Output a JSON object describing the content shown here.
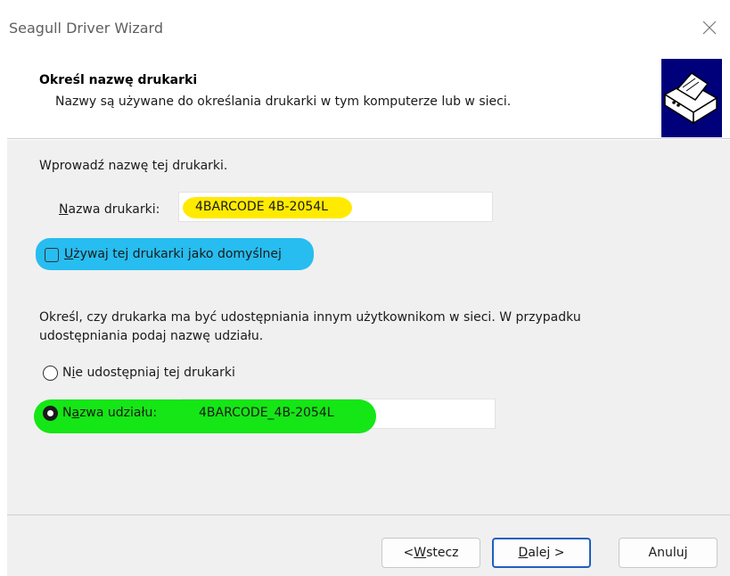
{
  "window": {
    "title": "Seagull Driver Wizard"
  },
  "header": {
    "title": "Określ nazwę drukarki",
    "subtitle": "Nazwy są używane do określania drukarki w tym komputerze lub w sieci."
  },
  "name_section": {
    "instruction": "Wprowadź nazwę tej drukarki.",
    "printer_name_label_mnemonic": "N",
    "printer_name_label_rest": "azwa drukarki:",
    "printer_name_value": "4BARCODE 4B-2054L",
    "default_checkbox_mnemonic": "U",
    "default_checkbox_rest": "żywaj tej drukarki jako domyślnej",
    "default_checked": false
  },
  "share_section": {
    "instruction_line1": "Określ, czy drukarka ma być udostępniania innym użytkownikom w sieci. W przypadku",
    "instruction_line2": "udostępniania podaj nazwę udziału.",
    "no_share_pre": "N",
    "no_share_mnemonic": "i",
    "no_share_rest": "e udostępniaj tej drukarki",
    "share_name_pre": "N",
    "share_name_mnemonic": "a",
    "share_name_rest": "zwa udziału:",
    "share_name_value": "4BARCODE_4B-2054L",
    "selected": "share"
  },
  "buttons": {
    "back_pre": "< ",
    "back_mnemonic": "W",
    "back_rest": "stecz",
    "next_mnemonic": "D",
    "next_rest": "alej >",
    "cancel": "Anuluj"
  },
  "colors": {
    "highlight_yellow": "#ffea00",
    "highlight_blue": "#27bdf0",
    "highlight_green": "#15e615",
    "dialog_bg": "#f0f0f0",
    "icon_bg": "#00007a"
  },
  "icons": {
    "close": "close-icon",
    "printer": "printer-icon"
  }
}
